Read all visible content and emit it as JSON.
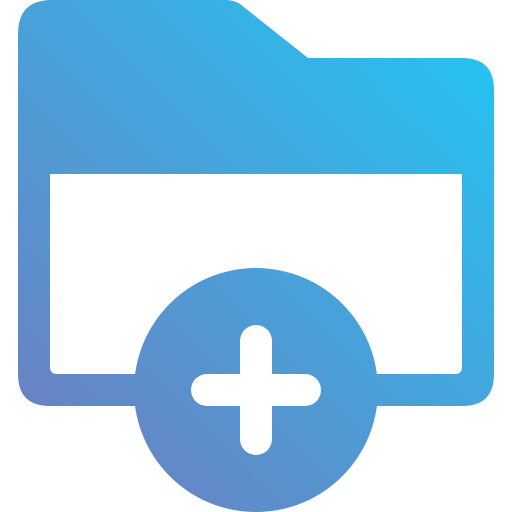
{
  "icon": {
    "name": "folder-add-icon",
    "gradient": {
      "start": "#7478bc",
      "end": "#1fc8f5"
    },
    "window_fill": "#ffffff",
    "plus_fill": "#ffffff"
  }
}
